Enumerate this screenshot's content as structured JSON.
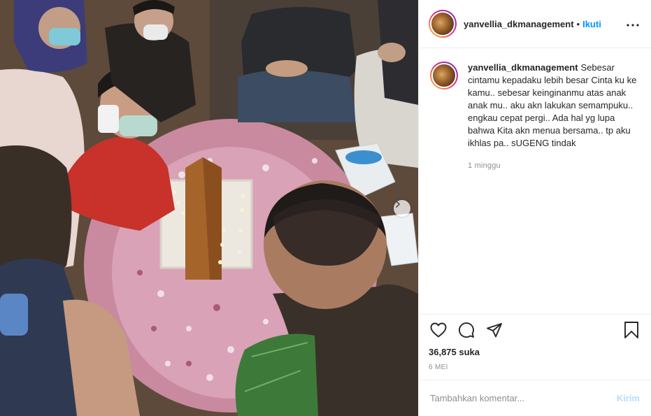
{
  "post": {
    "username": "yanvellia_dkmanagement",
    "separator": "•",
    "follow_label": "Ikuti",
    "more_icon": "more-horizontal-icon"
  },
  "caption": {
    "username": "yanvellia_dkmanagement",
    "text": "Sebesar cintamu kepadaku lebih besar Cinta ku ke kamu.. sebesar keinginanmu atas anak anak mu.. aku akn lakukan semampuku.. engkau cepat pergi.. Ada hal yg lupa bahwa Kita akn menua bersama.. tp aku ikhlas pa.. sUGENG tindak",
    "time": "1 minggu"
  },
  "actions": {
    "like_icon": "heart-icon",
    "comment_icon": "comment-icon",
    "share_icon": "share-icon",
    "save_icon": "bookmark-icon",
    "likes_text": "36,875 suka",
    "date": "6 MEI"
  },
  "comment_form": {
    "placeholder": "Tambahkan komentar...",
    "value": "",
    "post_label": "Kirim"
  },
  "colors": {
    "accent": "#0095f6",
    "post_disabled": "#b2dffc",
    "muted": "#8e8e8e"
  }
}
